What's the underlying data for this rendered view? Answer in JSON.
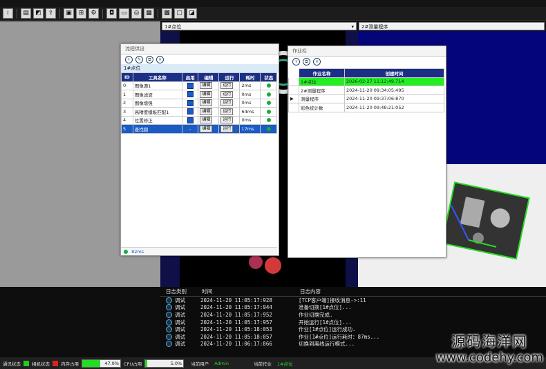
{
  "toolbar": {
    "buttons": [
      "info-icon",
      "save-icon",
      "export-icon",
      "import-icon",
      "toolbox-icon",
      "layout-icon",
      "settings-icon",
      "camera-icon",
      "monitor-icon",
      "target-icon",
      "calculator-icon",
      "grid-icon",
      "window-icon",
      "image-icon"
    ]
  },
  "view": {
    "left_dropdown": "1#点位",
    "right_dropdown": "2#测量程序"
  },
  "flow_panel": {
    "title": "流程供设",
    "group_label": "1#点位",
    "columns": [
      "ID",
      "工具名称",
      "启用",
      "编辑",
      "运行",
      "耗时",
      "状态"
    ],
    "rows": [
      {
        "id": "0",
        "name": "图像源1",
        "time": "2ms",
        "selected": false
      },
      {
        "id": "1",
        "name": "图像滤波",
        "time": "0ms",
        "selected": false
      },
      {
        "id": "2",
        "name": "图像增强",
        "time": "0ms",
        "selected": false
      },
      {
        "id": "3",
        "name": "高精度模板匹配1",
        "time": "64ms",
        "selected": false
      },
      {
        "id": "4",
        "name": "位置修正",
        "time": "0ms",
        "selected": false
      },
      {
        "id": "5",
        "name": "查找圆",
        "time": "17ms",
        "selected": true
      }
    ],
    "edit_label": "编辑",
    "run_label": "运行",
    "footer_time": "82ms"
  },
  "job_panel": {
    "title": "作业栏",
    "columns": [
      "作业名称",
      "创建时间"
    ],
    "rows": [
      {
        "name": "1#点位",
        "time": "2026-02-27 11:12:49.714",
        "highlight": true,
        "marker": ""
      },
      {
        "name": "2#测量程序",
        "time": "2024-11-20 09:34:05:495",
        "highlight": false,
        "marker": ""
      },
      {
        "name": "测量程序",
        "time": "2024-11-20 09:37:06:870",
        "highlight": false,
        "marker": "▶"
      },
      {
        "name": "彩色统计数",
        "time": "2024-11-20 09:48:21:052",
        "highlight": false,
        "marker": ""
      }
    ]
  },
  "log": {
    "headers": [
      "日志类别",
      "时间",
      "日志内容"
    ],
    "rows": [
      {
        "type": "调试",
        "time": "2024-11-20 11:05:17:928",
        "msg": "[TCP客户端]接收消息->:11"
      },
      {
        "type": "调试",
        "time": "2024-11-20 11:05:17:944",
        "msg": "准备切换[1#点位]..."
      },
      {
        "type": "调试",
        "time": "2024-11-20 11:05:17:952",
        "msg": "作业切换完成."
      },
      {
        "type": "调试",
        "time": "2024-11-20 11:05:17:957",
        "msg": "开始运行[1#点位]..."
      },
      {
        "type": "调试",
        "time": "2024-11-20 11:05:18:053",
        "msg": "作业[1#点位]运行成功."
      },
      {
        "type": "调试",
        "time": "2024-11-20 11:05:18:057",
        "msg": "作业[1#点位]运行耗时：87ms..."
      },
      {
        "type": "调试",
        "time": "2024-11-20 11:06:17:866",
        "msg": "切换到离线运行模式..."
      }
    ]
  },
  "status": {
    "comm_label": "通讯状态",
    "camera_label": "相机状态",
    "mem_label": "内存占用",
    "mem_value": "47.0%",
    "mem_fraction": 0.47,
    "cpu_label": "CPU占用",
    "cpu_value": "5.0%",
    "cpu_fraction": 0.05,
    "user_label": "当前用户",
    "user_value": "Admin",
    "job_label": "当前作业",
    "job_value": "1#点位",
    "colors": {
      "comm": "#22cc22",
      "camera": "#dd2222"
    }
  },
  "watermark": {
    "line1": "源码海洋网",
    "line2": "www.codehy.com"
  }
}
